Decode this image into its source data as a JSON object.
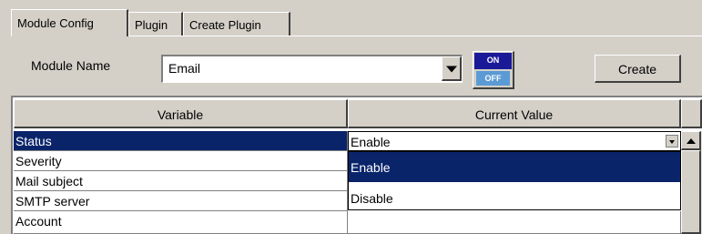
{
  "tabs": [
    {
      "label": "Module Config",
      "active": true
    },
    {
      "label": "Plugin",
      "active": false
    },
    {
      "label": "Create Plugin",
      "active": false
    }
  ],
  "module": {
    "label": "Module Name",
    "value": "Email",
    "toggle_on": "ON",
    "toggle_off": "OFF",
    "create_label": "Create"
  },
  "table": {
    "columns": [
      "Variable",
      "Current Value"
    ],
    "rows": [
      {
        "variable": "Status",
        "value": "Enable",
        "selected": true
      },
      {
        "variable": "Severity",
        "value": ""
      },
      {
        "variable": "Mail subject",
        "value": ""
      },
      {
        "variable": "SMTP server",
        "value": ""
      },
      {
        "variable": "Account",
        "value": ""
      }
    ]
  },
  "dropdown": {
    "options": [
      "Enable",
      "Disable"
    ],
    "highlighted": "Enable"
  },
  "colors": {
    "selection": "#0a246a",
    "toggle_on": "#1a1a99",
    "toggle_off": "#5b9bd5"
  }
}
